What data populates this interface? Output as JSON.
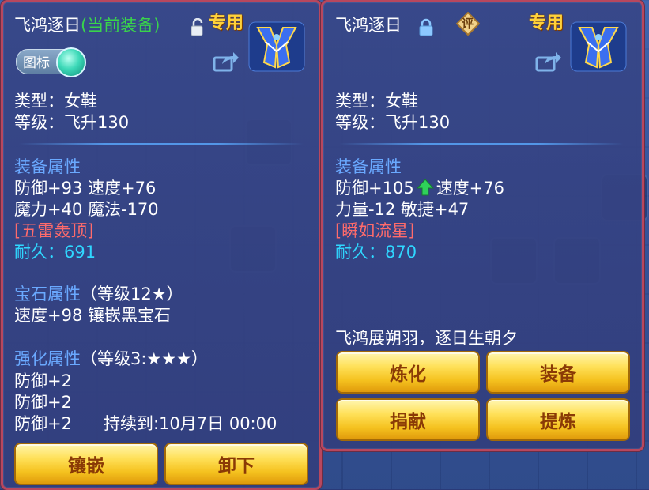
{
  "left": {
    "title": "飞鸿逐日",
    "equipped_tag": "(当前装备)",
    "exclusive": "专用",
    "icon_toggle": "图标",
    "type": "类型：女鞋",
    "level": "等级：飞升130",
    "attr_header": "装备属性",
    "attr_line1": "防御+93 速度+76",
    "attr_line2": "魔力+40 魔法-170",
    "special": "[五雷轰顶]",
    "durability": "耐久：691",
    "gem_header": "宝石属性",
    "gem_level": "（等级12★）",
    "gem_line": "速度+98 镶嵌黑宝石",
    "enh_header": "强化属性",
    "enh_level": "（等级3:★★★）",
    "enh_line1": "防御+2",
    "enh_line2": "防御+2",
    "enh_line3": "防御+2",
    "enh_duration": "持续到:10月7日 00:00",
    "btn_inlay": "镶嵌",
    "btn_unequip": "卸下"
  },
  "right": {
    "title": "飞鸿逐日",
    "rate_badge": "评",
    "exclusive": "专用",
    "type": "类型：女鞋",
    "level": "等级：飞升130",
    "attr_header": "装备属性",
    "attr_line1a": "防御+105",
    "attr_line1b": "速度+76",
    "attr_line2": "力量-12 敏捷+47",
    "special": "[瞬如流星]",
    "durability": "耐久：870",
    "flavor": "飞鸿展朔羽，逐日生朝夕",
    "btn_refine": "炼化",
    "btn_equip": "装备",
    "btn_donate": "捐献",
    "btn_extract": "提炼"
  },
  "colors": {
    "panel_border": "#b8475e",
    "equipped_green": "#39d44b",
    "section_blue": "#6aa9ff",
    "durability_cyan": "#2fd7ff",
    "special_red": "#ff6b6b",
    "exclusive_gold": "#ffd23a",
    "button_gold": "#f5c21f"
  },
  "icons": [
    "lock-open-icon",
    "lock-closed-icon",
    "share-icon",
    "boots-item-icon",
    "rating-badge-icon",
    "arrow-up-icon",
    "toggle-knob-icon"
  ]
}
